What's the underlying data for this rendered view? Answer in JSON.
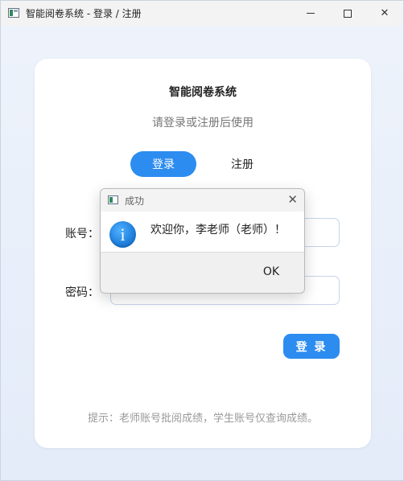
{
  "window": {
    "title": "智能阅卷系统 - 登录 / 注册",
    "controls": {
      "minimize_icon": "minimize-icon",
      "maximize_icon": "maximize-icon",
      "close_icon": "close-icon",
      "close_glyph": "✕"
    }
  },
  "card": {
    "title": "智能阅卷系统",
    "subtitle": "请登录或注册后使用",
    "tabs": [
      {
        "label": "登录",
        "selected": true
      },
      {
        "label": "注册",
        "selected": false
      }
    ],
    "account": {
      "label": "账号：",
      "value": "",
      "placeholder": ""
    },
    "password": {
      "label": "密码：",
      "value": "",
      "placeholder": ""
    },
    "submit_label": "登 录",
    "hint": "提示：老师账号批阅成绩，学生账号仅查询成绩。"
  },
  "dialog": {
    "title": "成功",
    "close_glyph": "✕",
    "info_glyph": "i",
    "message": "欢迎你，李老师（老师）！",
    "ok_label": "OK"
  },
  "colors": {
    "accent": "#2d8cf0",
    "background": "#e8eef8",
    "card": "#ffffff"
  }
}
